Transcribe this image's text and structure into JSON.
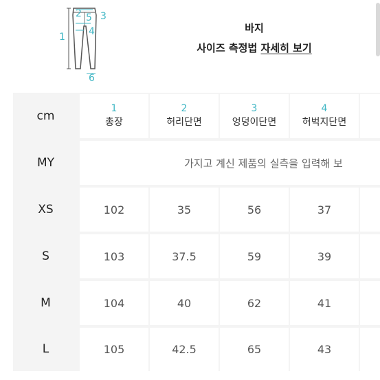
{
  "figure": {
    "labels": [
      "1",
      "2",
      "3",
      "4",
      "5",
      "6"
    ]
  },
  "title": {
    "main": "바지",
    "sub_prefix": "사이즈 측정법 ",
    "sub_link": "자세히 보기"
  },
  "table": {
    "corner": "cm",
    "columns": [
      {
        "num": "1",
        "name": "총장"
      },
      {
        "num": "2",
        "name": "허리단면"
      },
      {
        "num": "3",
        "name": "엉덩이단면"
      },
      {
        "num": "4",
        "name": "허벅지단면"
      }
    ],
    "my_row": {
      "label": "MY",
      "placeholder": "가지고 계신 제품의 실측을 입력해 보"
    },
    "rows": [
      {
        "size": "XS",
        "values": [
          "102",
          "35",
          "56",
          "37"
        ]
      },
      {
        "size": "S",
        "values": [
          "103",
          "37.5",
          "59",
          "39"
        ]
      },
      {
        "size": "M",
        "values": [
          "104",
          "40",
          "62",
          "41"
        ]
      },
      {
        "size": "L",
        "values": [
          "105",
          "42.5",
          "65",
          "43"
        ]
      }
    ]
  }
}
